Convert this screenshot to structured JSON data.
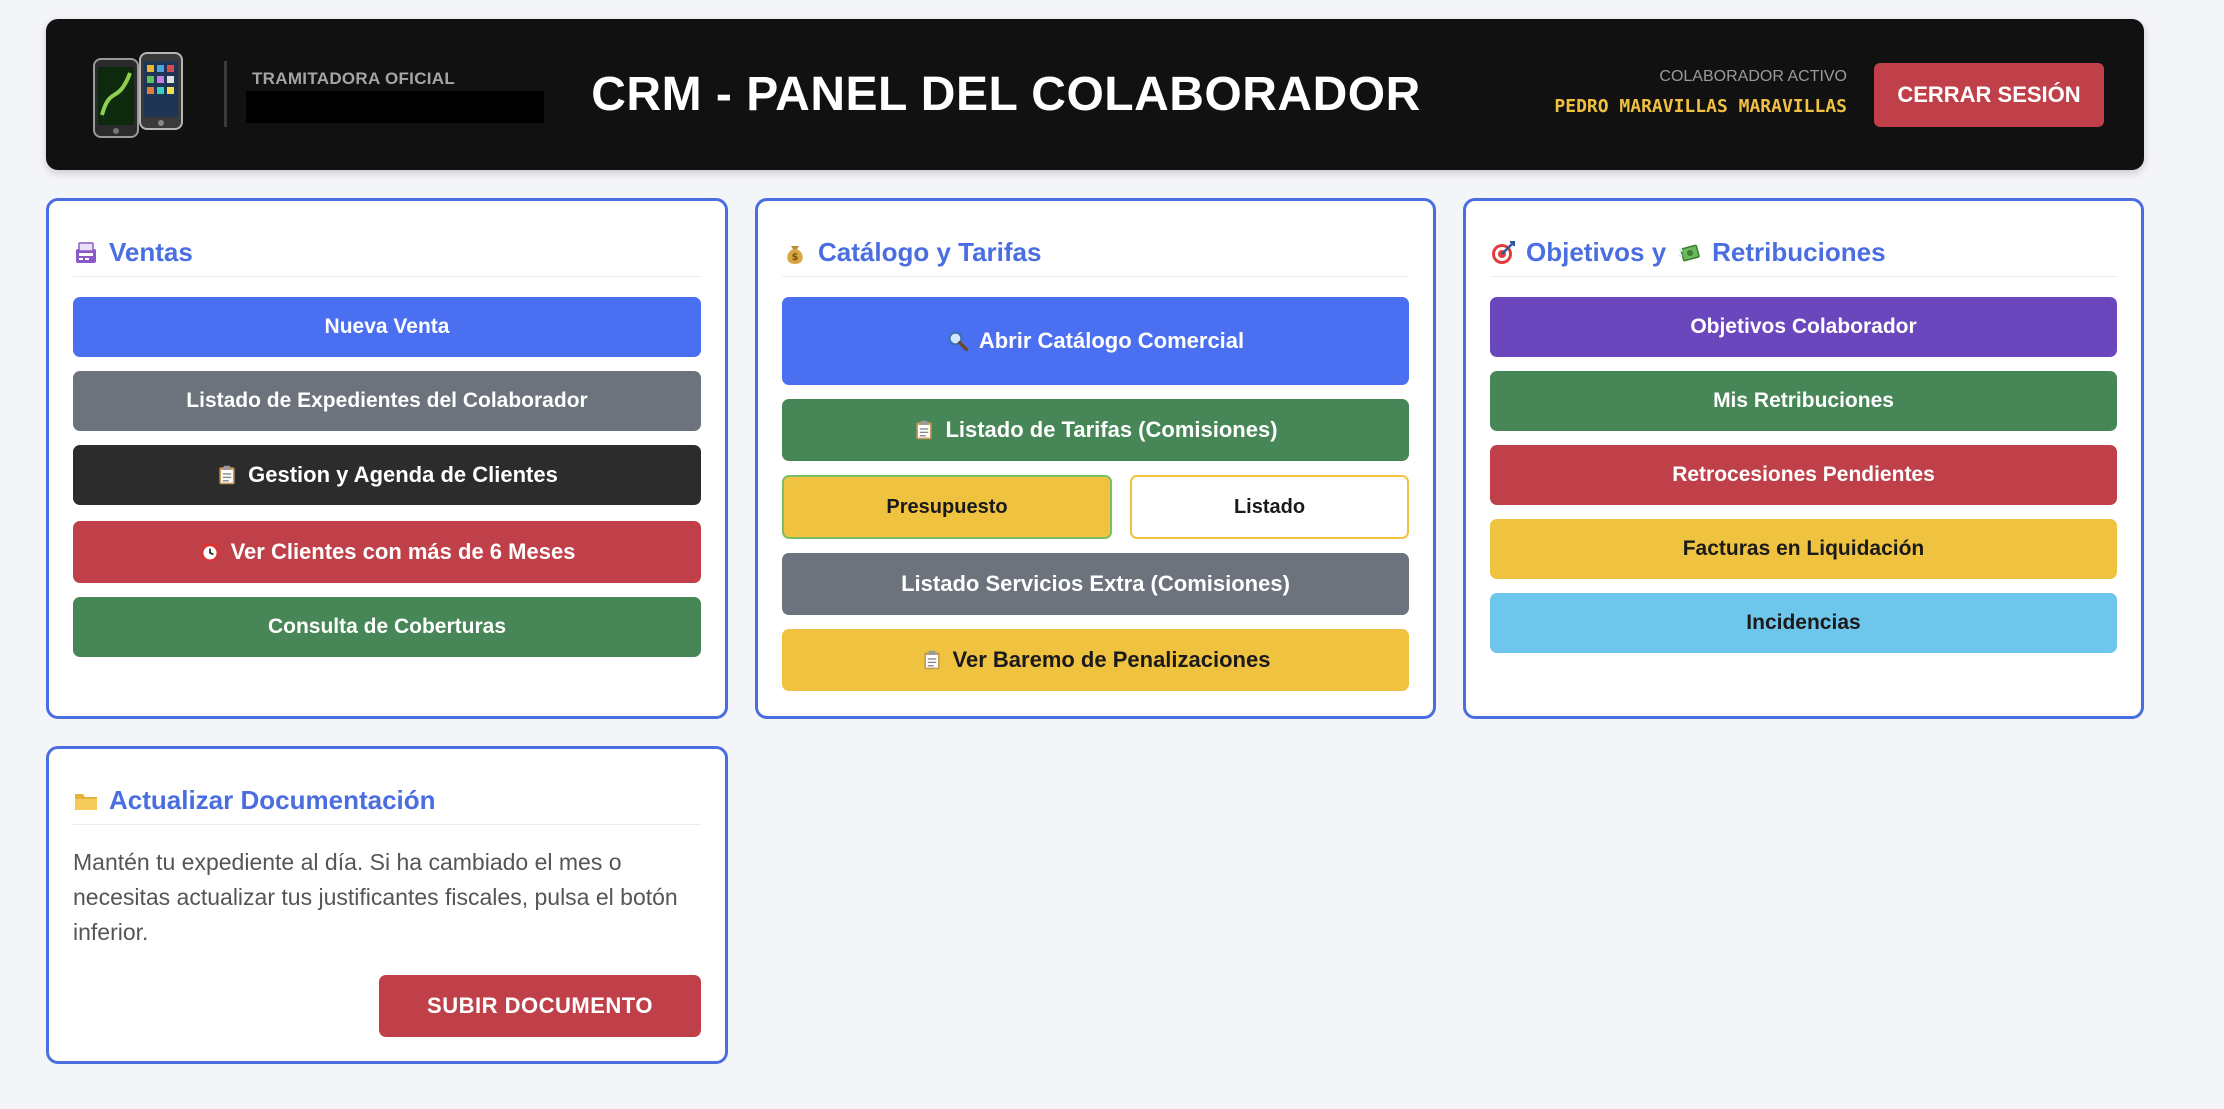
{
  "header": {
    "brand_caption": "TRAMITADORA OFICIAL",
    "title": "CRM - PANEL DEL COLABORADOR",
    "user_caption": "COLABORADOR ACTIVO",
    "user_name": "PEDRO MARAVILLAS MARAVILLAS",
    "logout_label": "CERRAR SESIÓN",
    "logo_icon": "smartphones-logo"
  },
  "ventas": {
    "title": "Ventas",
    "title_icon": "register-icon",
    "nueva_venta": "Nueva Venta",
    "listado_expedientes": "Listado de Expedientes del Colaborador",
    "gestion_agenda": "Gestion y Agenda de Clientes",
    "ver_clientes_6_meses": "Ver Clientes con más de 6 Meses",
    "consulta_coberturas": "Consulta de Coberturas"
  },
  "catalogo": {
    "title": "Catálogo y Tarifas",
    "title_icon": "money-bag-icon",
    "abrir_catalogo": "Abrir Catálogo Comercial",
    "listado_tarifas": "Listado de Tarifas (Comisiones)",
    "presupuesto": "Presupuesto",
    "listado": "Listado",
    "servicios_extra": "Listado Servicios Extra (Comisiones)",
    "baremo": "Ver Baremo de Penalizaciones"
  },
  "objetivos": {
    "title_part1": "Objetivos y",
    "title_part2": "Retribuciones",
    "title_icon": "target-icon",
    "title_icon2": "money-wings-icon",
    "objetivos_colaborador": "Objetivos Colaborador",
    "mis_retribuciones": "Mis Retribuciones",
    "retrocesiones": "Retrocesiones Pendientes",
    "facturas": "Facturas en Liquidación",
    "incidencias": "Incidencias"
  },
  "documentacion": {
    "title": "Actualizar Documentación",
    "title_icon": "folder-icon",
    "description": "Mantén tu expediente al día. Si ha cambiado el mes o necesitas actualizar tus justificantes fiscales, pulsa el botón inferior.",
    "upload_label": "SUBIR DOCUMENTO"
  },
  "colors": {
    "accent": "#4a6ee0",
    "primary": "#4a6ff0",
    "danger": "#c0404a",
    "success": "#478656",
    "warning": "#efc240",
    "info": "#6fc6ec",
    "purple": "#6b47bd",
    "secondary": "#6c737c",
    "dark": "#2c2c2c",
    "header_bg": "#111111",
    "user_name": "#f0c040"
  }
}
